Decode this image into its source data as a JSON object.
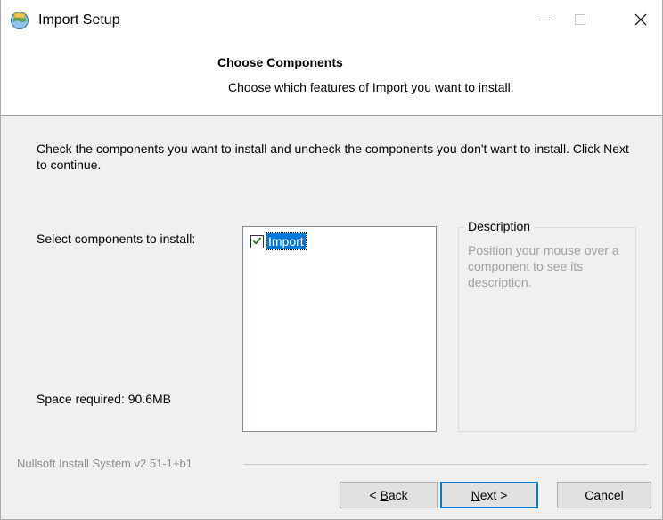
{
  "window": {
    "title": "Import Setup"
  },
  "header": {
    "title": "Choose Components",
    "subtitle": "Choose which features of Import you want to install."
  },
  "body": {
    "intro": "Check the components you want to install and uncheck the components you don't want to install. Click Next to continue.",
    "select_label": "Select components to install:",
    "space_required": "Space required: 90.6MB"
  },
  "components": {
    "items": [
      {
        "label": "Import",
        "checked": true,
        "selected": true
      }
    ]
  },
  "description": {
    "legend": "Description",
    "text": "Position your mouse over a component to see its description."
  },
  "footer": {
    "branding": "Nullsoft Install System v2.51-1+b1",
    "back_pre": "< ",
    "back_accel": "B",
    "back_post": "ack",
    "next_accel": "N",
    "next_post": "ext >",
    "cancel_label": "Cancel"
  },
  "colors": {
    "selection": "#0078d7",
    "window_bg": "#f0f0f0",
    "check": "#1e7a1e"
  },
  "icons": {
    "app": "installer-globe-icon",
    "minimize": "minimize-icon",
    "maximize": "maximize-icon",
    "close": "close-icon",
    "check": "checkmark-icon"
  }
}
